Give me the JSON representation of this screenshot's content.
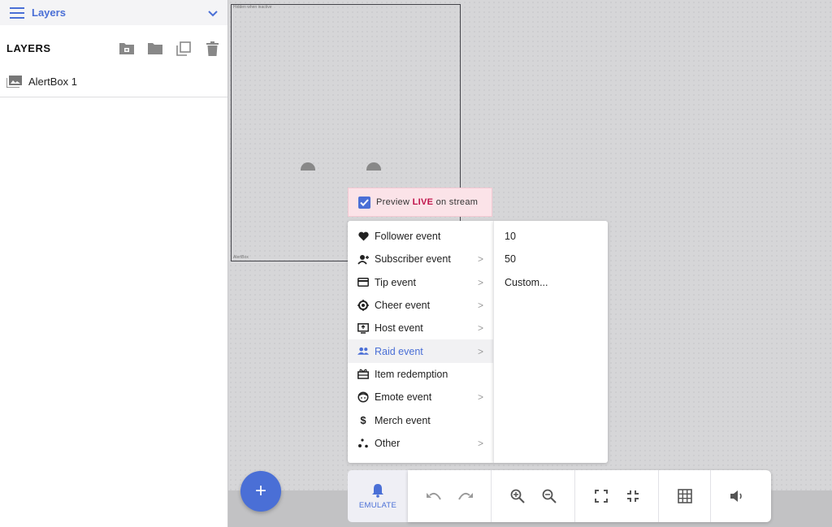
{
  "layers_panel": {
    "header_title": "Layers",
    "section_label": "LAYERS",
    "layer_items": [
      {
        "label": "AlertBox 1"
      }
    ]
  },
  "canvas": {
    "frame_caption_top": "Hidden when inactive",
    "frame_caption_bottom": "AlertBox"
  },
  "preview": {
    "prefix": "Preview ",
    "live": "LIVE",
    "suffix": " on stream",
    "checked": true
  },
  "event_menu": {
    "items": [
      {
        "label": "Follower event",
        "icon": "heart-icon",
        "submenu": false
      },
      {
        "label": "Subscriber event",
        "icon": "subscriber-icon",
        "submenu": true
      },
      {
        "label": "Tip event",
        "icon": "credit-card-icon",
        "submenu": true
      },
      {
        "label": "Cheer event",
        "icon": "cheer-icon",
        "submenu": true
      },
      {
        "label": "Host event",
        "icon": "host-icon",
        "submenu": true
      },
      {
        "label": "Raid event",
        "icon": "raid-icon",
        "submenu": true,
        "active": true
      },
      {
        "label": "Item redemption",
        "icon": "gift-icon",
        "submenu": false
      },
      {
        "label": "Emote event",
        "icon": "emote-icon",
        "submenu": true
      },
      {
        "label": "Merch event",
        "icon": "dollar-icon",
        "submenu": false
      },
      {
        "label": "Other",
        "icon": "other-icon",
        "submenu": true
      }
    ],
    "arrow": ">"
  },
  "submenu": {
    "items": [
      "10",
      "50",
      "Custom..."
    ]
  },
  "fab": {
    "symbol": "+"
  },
  "emulate": {
    "label": "EMULATE"
  },
  "colors": {
    "accent": "#4a6fd6",
    "live": "#c0144b",
    "preview_bg": "#fbe3e8"
  }
}
